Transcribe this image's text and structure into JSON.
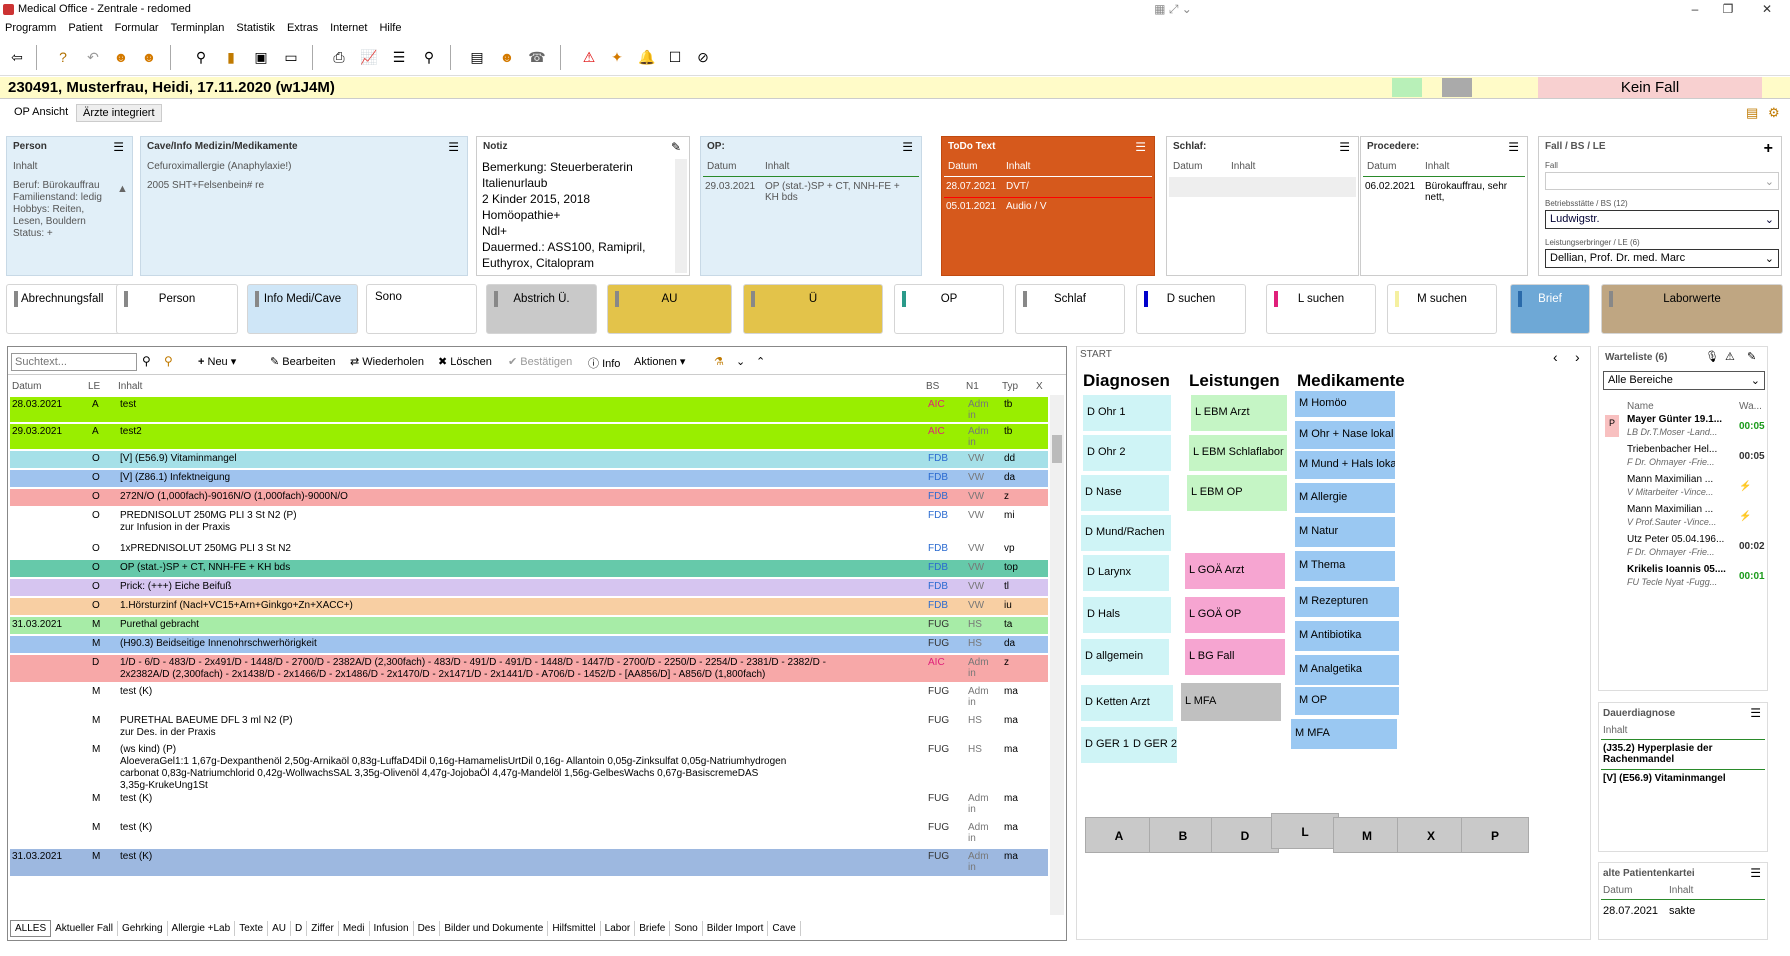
{
  "app": {
    "title": "Medical Office - Zentrale - redomed"
  },
  "menu": [
    "Programm",
    "Patient",
    "Formular",
    "Terminplan",
    "Statistik",
    "Extras",
    "Internet",
    "Hilfe"
  ],
  "patient": {
    "header": "230491, Musterfrau, Heidi, 17.11.2020 (w1J4M)",
    "fall": "Kein Fall"
  },
  "views": {
    "op": "OP Ansicht",
    "aerzte": "Ärzte integriert"
  },
  "cards": {
    "person": {
      "title": "Person",
      "inhalt": "Inhalt",
      "text": "Beruf: Bürokauffrau\nFamilienstand: ledig\nHobbys: Reiten, Lesen, Bouldern\nStatus:  +"
    },
    "cave": {
      "title": "Cave/Info Medizin/Medikamente",
      "line1": "Cefuroximallergie (Anaphylaxie!)",
      "line2": "2005 SHT+Felsenbein# re"
    },
    "notiz": {
      "title": "Notiz",
      "text": "Bemerkung: Steuerberaterin\nItalienurlaub\n2 Kinder 2015, 2018\nHomöopathie+\nNdl+\nDauermed.: ASS100, Ramipril,\nEuthyrox, Citalopram"
    },
    "op": {
      "title": "OP:",
      "datum": "Datum",
      "inhalt": "Inhalt",
      "d1": "29.03.2021",
      "t1": "OP (stat.-)SP + CT, NNH-FE + KH bds"
    },
    "todo": {
      "title": "ToDo Text",
      "datum": "Datum",
      "inhalt": "Inhalt",
      "d1": "28.07.2021",
      "t1": "DVT/",
      "d2": "05.01.2021",
      "t2": "Audio / V"
    },
    "schlaf": {
      "title": "Schlaf:",
      "datum": "Datum",
      "inhalt": "Inhalt"
    },
    "procedere": {
      "title": "Procedere:",
      "datum": "Datum",
      "inhalt": "Inhalt",
      "d1": "06.02.2021",
      "t1": "Bürokauffrau, sehr nett,"
    },
    "fall": {
      "title": "Fall / BS / LE",
      "l1": "Fall",
      "l2": "Betriebsstätte / BS (12)",
      "v2": "Ludwigstr.",
      "l3": "Leistungserbringer / LE (6)",
      "v3": "Dellian, Prof. Dr. med. Marc"
    }
  },
  "buttons": [
    "Abrechnungsfall",
    "Person",
    "Info Medi/Cave",
    "Sono",
    "Abstrich Ü.",
    "AU",
    "Ü",
    "OP",
    "Schlaf",
    "D suchen",
    "L suchen",
    "M suchen",
    "Brief",
    "Laborwerte"
  ],
  "gridtoolbar": {
    "search_placeholder": "Suchtext...",
    "neu": "Neu",
    "bearbeiten": "Bearbeiten",
    "wiederholen": "Wiederholen",
    "loeschen": "Löschen",
    "bestaetigen": "Bestätigen",
    "info": "Info",
    "aktionen": "Aktionen"
  },
  "gridheader": {
    "datum": "Datum",
    "le": "LE",
    "inhalt": "Inhalt",
    "bs": "BS",
    "n1": "N1",
    "typ": "Typ",
    "x": "X"
  },
  "rows": [
    {
      "d": "28.03.2021",
      "le": "A",
      "t": "test",
      "bs": "AIC",
      "n1": "Admin",
      "typ": "tb",
      "bg": "#99ee00"
    },
    {
      "d": "29.03.2021",
      "le": "A",
      "t": "test2",
      "bs": "AIC",
      "n1": "Admin",
      "typ": "tb",
      "bg": "#99ee00"
    },
    {
      "d": "",
      "le": "O",
      "t": "[V] (E56.9) Vitaminmangel",
      "bs": "FDB",
      "n1": "VW",
      "typ": "dd",
      "bg": "#a5e0e8"
    },
    {
      "d": "",
      "le": "O",
      "t": "[V] (Z86.1) Infektneigung",
      "bs": "FDB",
      "n1": "VW",
      "typ": "da",
      "bg": "#9fc3ee"
    },
    {
      "d": "",
      "le": "O",
      "t": "272N/O (1,000fach)-9016N/O (1,000fach)-9000N/O",
      "bs": "FDB",
      "n1": "VW",
      "typ": "z",
      "bg": "#f7a8a8"
    },
    {
      "d": "",
      "le": "O",
      "t": "PREDNISOLUT 250MG PLI 3 St N2 (P)\nzur Infusion in der Praxis",
      "bs": "FDB",
      "n1": "VW",
      "typ": "mi",
      "bg": "#ffffff"
    },
    {
      "d": "",
      "le": "O",
      "t": "1xPREDNISOLUT 250MG PLI 3 St N2",
      "bs": "FDB",
      "n1": "VW",
      "typ": "vp",
      "bg": "#ffffff"
    },
    {
      "d": "",
      "le": "O",
      "t": "OP (stat.-)SP + CT, NNH-FE + KH bds",
      "bs": "FDB",
      "n1": "VW",
      "typ": "top",
      "bg": "#66c9aa"
    },
    {
      "d": "",
      "le": "O",
      "t": "Prick: (+++) Eiche Beifuß",
      "bs": "FDB",
      "n1": "VW",
      "typ": "tl",
      "bg": "#d6c5f0"
    },
    {
      "d": "",
      "le": "O",
      "t": "1.Hörsturzinf (Nacl+VC15+Arn+Ginkgo+Zn+XACC+)",
      "bs": "FDB",
      "n1": "VW",
      "typ": "iu",
      "bg": "#f8cfa3"
    },
    {
      "d": "31.03.2021",
      "le": "M",
      "t": "Purethal gebracht",
      "bs": "FUG",
      "n1": "HS",
      "typ": "ta",
      "bg": "#a7eca7"
    },
    {
      "d": "",
      "le": "M",
      "t": "(H90.3) Beidseitige Innenohrschwerhörigkeit",
      "bs": "FUG",
      "n1": "HS",
      "typ": "da",
      "bg": "#9fc3ee"
    },
    {
      "d": "",
      "le": "D",
      "t": "1/D - 6/D - 483/D - 2x491/D - 1448/D - 2700/D - 2382A/D (2,300fach) - 483/D - 491/D - 491/D - 1448/D - 1447/D - 2700/D - 2250/D - 2254/D - 2381/D - 2382/D -\n2x2382A/D (2,300fach) - 2x1438/D - 2x1466/D - 2x1486/D - 2x1470/D - 2x1471/D - 2x1441/D - A706/D - 1452/D - [AA856/D] - A856/D (1,800fach)",
      "bs": "AIC",
      "n1": "Admin",
      "typ": "z",
      "bg": "#f7a8a8"
    },
    {
      "d": "",
      "le": "M",
      "t": "test (K)",
      "bs": "FUG",
      "n1": "Admin",
      "typ": "ma",
      "bg": "#ffffff"
    },
    {
      "d": "",
      "le": "M",
      "t": "PURETHAL BAEUME DFL 3 ml N2 (P)\nzur Des. in der Praxis",
      "bs": "FUG",
      "n1": "HS",
      "typ": "ma",
      "bg": "#ffffff"
    },
    {
      "d": "",
      "le": "M",
      "t": "(ws kind) (P)\nAloeveraGel1:1 1,67g-Dexpanthenöl 2,50g-Arnikaöl  0,83g-LuffaD4Dil 0,16g-HamamelisUrtDil 0,16g-  Allantoin 0,05g-Zinksulfat 0,05g-Natriumhydrogen\ncarbonat 0,83g-Natriumchlorid 0,42g-WollwachsSAL  3,35g-Olivenöl 4,47g-JojobaÖl 4,47g-Mandelöl 1,56g-GelbesWachs 0,67g-BasiscremeDAS\n3,35g-KrukeUng1St",
      "bs": "FUG",
      "n1": "HS",
      "typ": "ma",
      "bg": "#ffffff"
    },
    {
      "d": "",
      "le": "M",
      "t": "test (K)",
      "bs": "FUG",
      "n1": "Admin",
      "typ": "ma",
      "bg": "#ffffff"
    },
    {
      "d": "",
      "le": "M",
      "t": "test (K)",
      "bs": "FUG",
      "n1": "Admin",
      "typ": "ma",
      "bg": "#ffffff"
    },
    {
      "d": "31.03.2021",
      "le": "M",
      "t": "test (K)",
      "bs": "FUG",
      "n1": "Admin",
      "typ": "ma",
      "bg": "#9db8e0"
    }
  ],
  "bottomtabs": [
    "ALLES",
    "Aktueller Fall",
    "Gehrking",
    "Allergie +Lab",
    "Texte",
    "AU",
    "D",
    "Ziffer",
    "Medi",
    "Infusion",
    "Des",
    "Bilder und Dokumente",
    "Hilfsmittel",
    "Labor",
    "Briefe",
    "Sono",
    "Bilder Import",
    "Cave"
  ],
  "start": {
    "title": "START",
    "h1": "Diagnosen",
    "h2": "Leistungen",
    "h3": "Medikamente",
    "diag": [
      "D Ohr 1",
      "D Ohr 2",
      "D Nase",
      "D Mund/Rachen",
      "D Larynx",
      "D Hals",
      "D allgemein",
      "D Ketten Arzt",
      "D GER 1",
      "D GER 2"
    ],
    "leist": [
      "L EBM Arzt",
      "L EBM Schlaflabor",
      "L EBM OP",
      "L GOÄ Arzt",
      "L GOÄ OP",
      "L BG Fall",
      "L MFA"
    ],
    "medi": [
      "M Homöo",
      "M  Ohr + Nase lokal",
      "M Mund + Hals lokal",
      "M Allergie",
      "M Natur",
      "M Thema",
      "M Rezepturen",
      "M Antibiotika",
      "M Analgetika",
      "M OP",
      "M MFA"
    ],
    "big": [
      "A",
      "B",
      "D",
      "L",
      "M",
      "X",
      "P"
    ]
  },
  "warteliste": {
    "title": "Warteliste  (6)",
    "filter": "Alle Bereiche",
    "col_name": "Name",
    "col_wa": "Wa...",
    "items": [
      {
        "flag": "P",
        "name": "Mayer Günter 19.1...",
        "sub": "LB Dr.T.Moser -Land...",
        "time": "00:05",
        "tc": "#1a9a1a",
        "bold": true
      },
      {
        "flag": "",
        "name": "Triebenbacher Hel...",
        "sub": "F Dr. Ohmayer  -Frie...",
        "time": "00:05",
        "tc": "#333",
        "bold": false
      },
      {
        "flag": "",
        "name": "Mann Maximilian ...",
        "sub": "V Mitarbeiter  -Vince...",
        "time": "⚡",
        "tc": "#333",
        "bold": false
      },
      {
        "flag": "",
        "name": "Mann Maximilian ...",
        "sub": "V Prof.Sauter  -Vince...",
        "time": "⚡",
        "tc": "#333",
        "bold": false
      },
      {
        "flag": "",
        "name": "Utz Peter 05.04.196...",
        "sub": "F Dr. Ohmayer  -Frie...",
        "time": "00:02",
        "tc": "#333",
        "bold": false
      },
      {
        "flag": "",
        "name": "Krikelis Ioannis 05....",
        "sub": "FU Tecle Nyat  -Fugg...",
        "time": "00:01",
        "tc": "#1a9a1a",
        "bold": true
      }
    ]
  },
  "dauer": {
    "title": "Dauerdiagnose",
    "inhalt": "Inhalt",
    "i1": "(J35.2) Hyperplasie der Rachenmandel",
    "i2": "[V] (E56.9) Vitaminmangel"
  },
  "alte": {
    "title": "alte Patientenkartei",
    "datum": "Datum",
    "inhalt": "Inhalt",
    "d1": "28.07.2021",
    "t1": "sakte"
  }
}
